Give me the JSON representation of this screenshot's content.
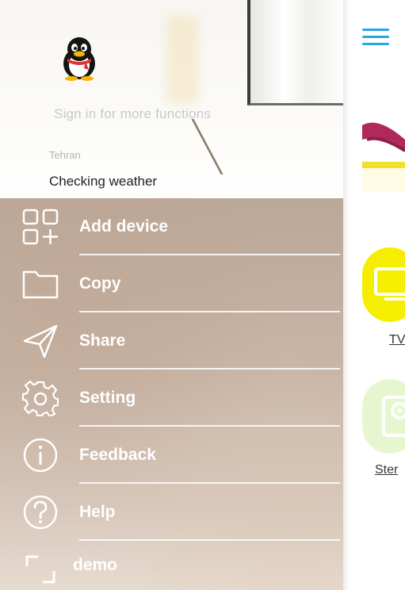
{
  "header": {
    "sign_in": "Sign in for more functions",
    "city": "Tehran",
    "weather": "Checking weather"
  },
  "menu": [
    {
      "label": "Add device",
      "icon": "add-device-grid-icon"
    },
    {
      "label": "Copy",
      "icon": "folder-icon"
    },
    {
      "label": "Share",
      "icon": "paper-plane-icon"
    },
    {
      "label": "Setting",
      "icon": "gear-icon"
    },
    {
      "label": "Feedback",
      "icon": "info-icon"
    },
    {
      "label": "Help",
      "icon": "help-icon"
    },
    {
      "label": "demo",
      "icon": "frame-corners-icon"
    }
  ],
  "right_panel": {
    "devices": [
      {
        "label": "TV",
        "color": "#f6ee00"
      },
      {
        "label": "Ster",
        "color": "#e6f7cf"
      }
    ],
    "accent": "#27a4e6"
  }
}
